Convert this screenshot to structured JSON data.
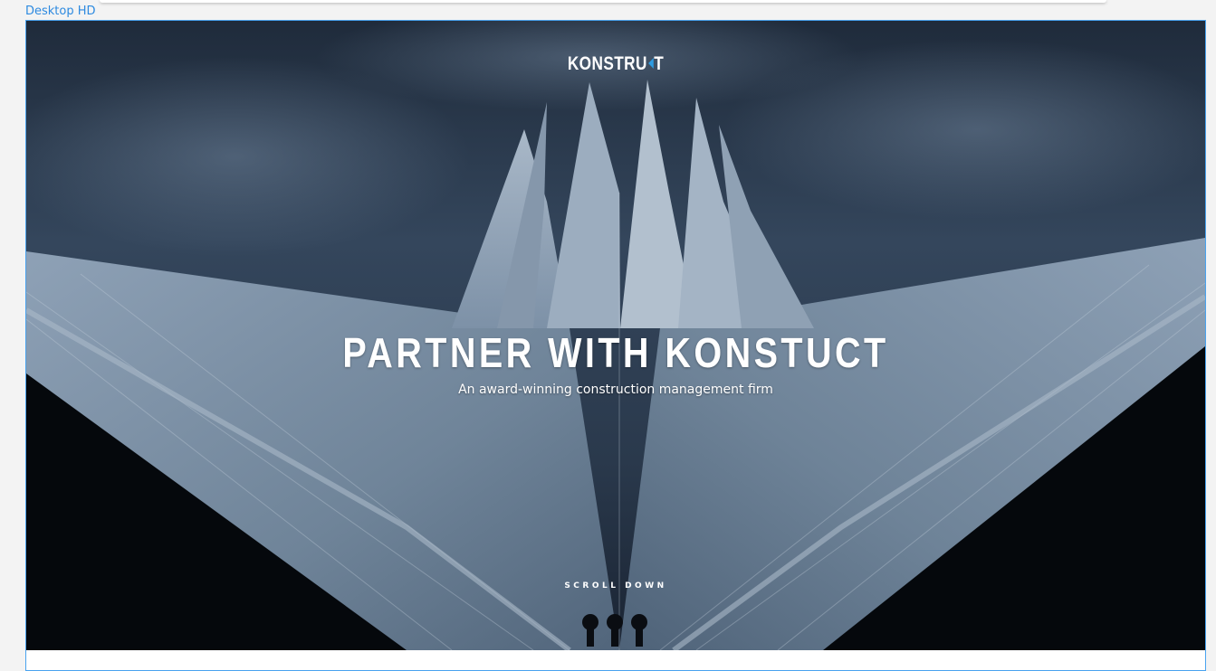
{
  "artboard": {
    "label": "Desktop HD"
  },
  "brand": {
    "logo_left": "KONSTRU",
    "logo_right": "T",
    "accent": "#2e9be0"
  },
  "hero": {
    "headline": "PARTNER WITH KONSTUCT",
    "subline": "An award-winning construction management firm",
    "scroll_label": "SCROLL DOWN"
  },
  "colors": {
    "selection": "#49a3ef",
    "label": "#2d8ae0",
    "canvas": "#f3f3f3"
  }
}
